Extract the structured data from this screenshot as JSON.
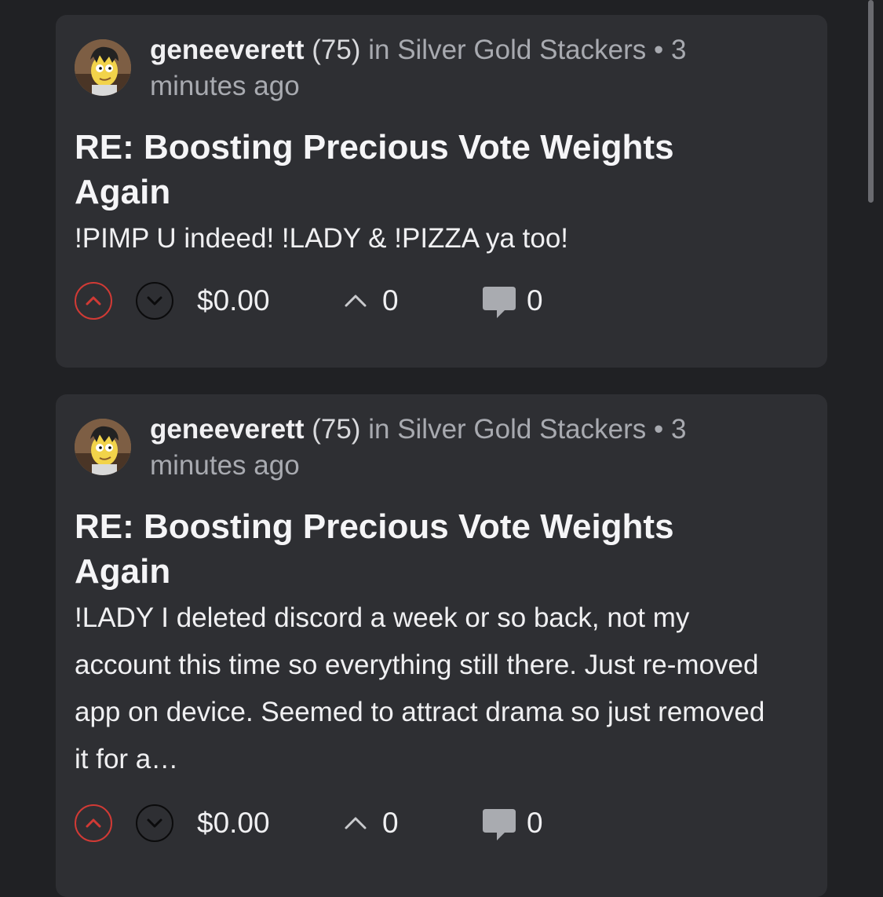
{
  "colors": {
    "background": "#202124",
    "card": "#2e2f33",
    "upvote_accent": "#d13a35",
    "muted_text": "#a8aab0"
  },
  "posts": [
    {
      "author": "geneeverett",
      "reputation": "(75)",
      "in_label": "in",
      "community": "Silver Gold Stackers",
      "separator": "•",
      "time": "3 minutes ago",
      "title": "RE: Boosting Precious Vote Weights Again",
      "body": "!PIMP U indeed! !LADY & !PIZZA ya too!",
      "payout": "$0.00",
      "votes": "0",
      "comments": "0",
      "icons": [
        "avatar",
        "upvote-icon",
        "downvote-icon",
        "votes-caret-icon",
        "comment-icon"
      ]
    },
    {
      "author": "geneeverett",
      "reputation": "(75)",
      "in_label": "in",
      "community": "Silver Gold Stackers",
      "separator": "•",
      "time": "3 minutes ago",
      "title": "RE: Boosting Precious Vote Weights Again",
      "body": "!LADY I deleted discord a week or so back, not my account this time so everything still there. Just re-moved app on device. Seemed to attract drama so just removed it for a…",
      "payout": "$0.00",
      "votes": "0",
      "comments": "0",
      "icons": [
        "avatar",
        "upvote-icon",
        "downvote-icon",
        "votes-caret-icon",
        "comment-icon"
      ]
    }
  ]
}
